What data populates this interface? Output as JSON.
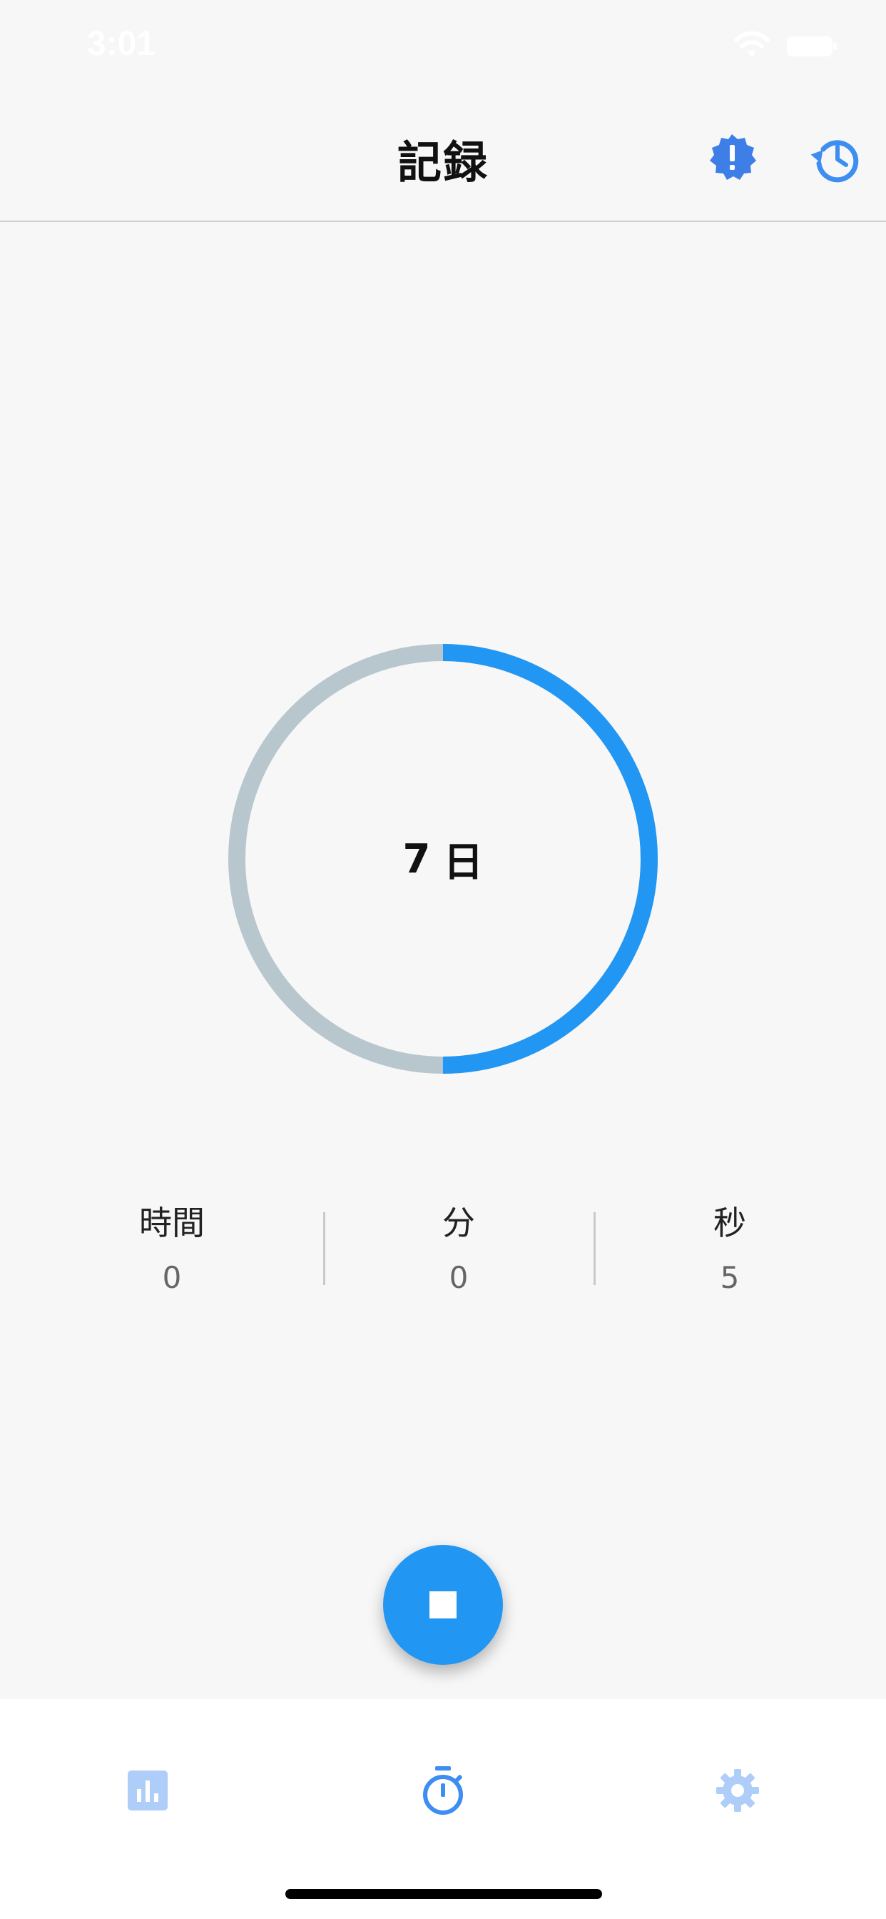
{
  "status_bar": {
    "time": "3:01"
  },
  "header": {
    "title": "記録",
    "icons": [
      "alert-badge-icon",
      "history-icon"
    ]
  },
  "ring": {
    "value": "7",
    "unit": "日",
    "progress": 0.5,
    "progress_color": "#2196f3",
    "track_color": "#b8c7cd"
  },
  "stats": [
    {
      "label": "時間",
      "value": "0"
    },
    {
      "label": "分",
      "value": "0"
    },
    {
      "label": "秒",
      "value": "5"
    }
  ],
  "fab": {
    "icon": "stop-icon",
    "color": "#2196f3"
  },
  "bottom_nav": {
    "items": [
      {
        "icon": "bar-chart-icon",
        "active": false
      },
      {
        "icon": "stopwatch-icon",
        "active": true
      },
      {
        "icon": "gear-icon",
        "active": false
      }
    ],
    "active_color": "#3d8ef0",
    "inactive_color": "#aecdf8"
  }
}
